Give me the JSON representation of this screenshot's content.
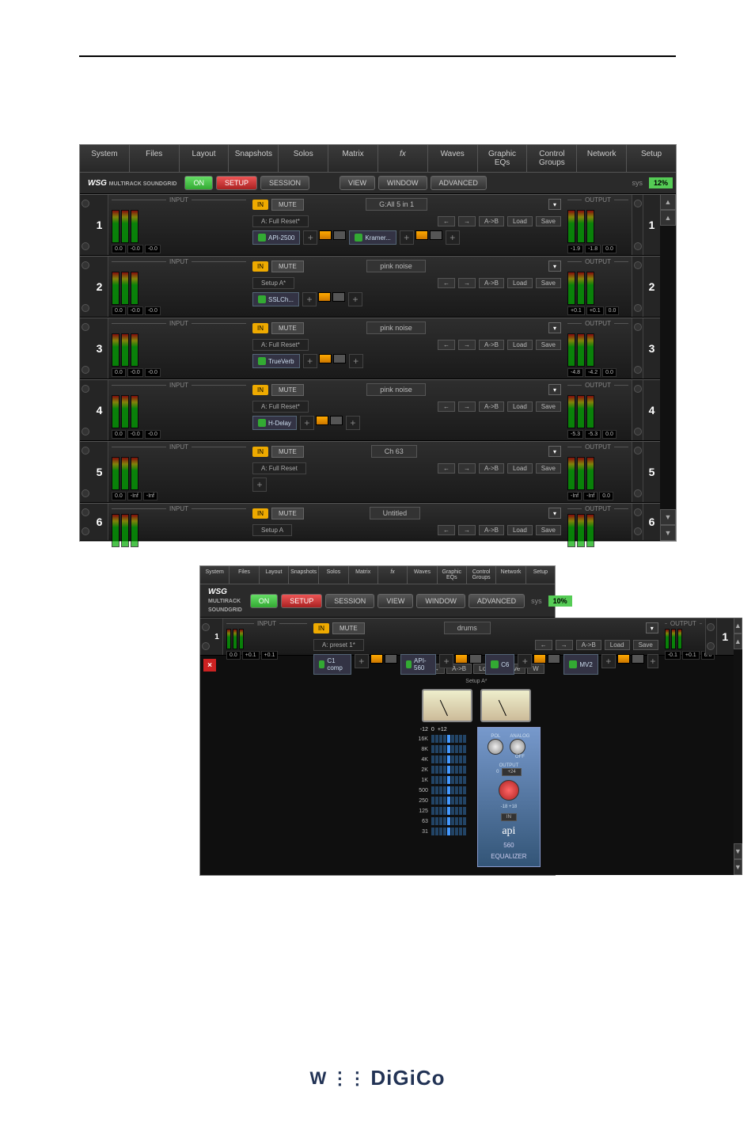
{
  "menubar": [
    "System",
    "Files",
    "Layout",
    "Snapshots",
    "Solos",
    "Matrix",
    "fx",
    "Waves",
    "Graphic EQs",
    "Control Groups",
    "Network",
    "Setup"
  ],
  "secbar": {
    "logo_main": "WSG",
    "logo_sub": "MULTIRACK SOUNDGRID",
    "on": "ON",
    "setup": "SETUP",
    "session": "SESSION",
    "view": "VIEW",
    "window": "WINDOW",
    "advanced": "ADVANCED",
    "sys": "sys",
    "pct": "12%"
  },
  "labels": {
    "input": "INPUT",
    "output": "OUTPUT",
    "in": "IN",
    "mute": "MUTE",
    "prev": "←",
    "next": "→",
    "ab": "A->B",
    "load": "Load",
    "save": "Save",
    "add": "+"
  },
  "racks": [
    {
      "no": "1",
      "name": "G:All 5 in 1",
      "preset": "A: Full Reset*",
      "plugins": [
        "API-2500",
        "Kramer..."
      ],
      "in_vals": [
        "0.0",
        "-0.0",
        "-0.0"
      ],
      "out_vals": [
        "-1.9",
        "-1.8",
        "0.0"
      ]
    },
    {
      "no": "2",
      "name": "pink noise",
      "preset": "Setup A*",
      "plugins": [
        "SSLCh..."
      ],
      "in_vals": [
        "0.0",
        "-0.0",
        "-0.0"
      ],
      "out_vals": [
        "+0.1",
        "+0.1",
        "0.0"
      ]
    },
    {
      "no": "3",
      "name": "pink noise",
      "preset": "A: Full Reset*",
      "plugins": [
        "TrueVerb"
      ],
      "in_vals": [
        "0.0",
        "-0.0",
        "-0.0"
      ],
      "out_vals": [
        "-4.8",
        "-4.2",
        "0.0"
      ]
    },
    {
      "no": "4",
      "name": "pink noise",
      "preset": "A: Full Reset*",
      "plugins": [
        "H-Delay"
      ],
      "in_vals": [
        "0.0",
        "-0.0",
        "-0.0"
      ],
      "out_vals": [
        "-5.3",
        "-5.3",
        "0.0"
      ]
    },
    {
      "no": "5",
      "name": "Ch 63",
      "preset": "A: Full Reset",
      "plugins": [],
      "in_vals": [
        "0.0",
        "-Inf",
        "-Inf"
      ],
      "out_vals": [
        "-Inf",
        "-Inf",
        "0.0"
      ]
    },
    {
      "no": "6",
      "name": "Untitled",
      "preset": "Setup A",
      "plugins": [],
      "in_vals": [],
      "out_vals": [],
      "short": true
    }
  ],
  "small_screenshot": {
    "pct": "10%",
    "rack": {
      "no": "1",
      "name": "drums",
      "preset": "A: preset 1*",
      "plugins": [
        "C1 comp",
        "API-560",
        "C6",
        "MV2"
      ],
      "in_vals": [
        "0.0",
        "+0.1",
        "+0.1"
      ],
      "out_vals": [
        "-0.1",
        "+0.1",
        "0.0"
      ]
    },
    "plugin_editor": {
      "preset": "Setup A*",
      "w_toggle": "W",
      "eq_header": [
        "-12",
        "0",
        "+12"
      ],
      "eq_rows": [
        "16K",
        "8K",
        "4K",
        "2K",
        "1K",
        "500",
        "250",
        "125",
        "63",
        "31"
      ],
      "api_labels": {
        "pol": "POL",
        "analog": "ANALOG",
        "off": "OFF",
        "output": "OUTPUT",
        "out_val": "0",
        "hp": "+24",
        "range": "-18  +18",
        "in": "IN",
        "logo": "api",
        "model": "560",
        "sub": "EQUALIZER"
      }
    }
  },
  "footer": "DiGiCo"
}
